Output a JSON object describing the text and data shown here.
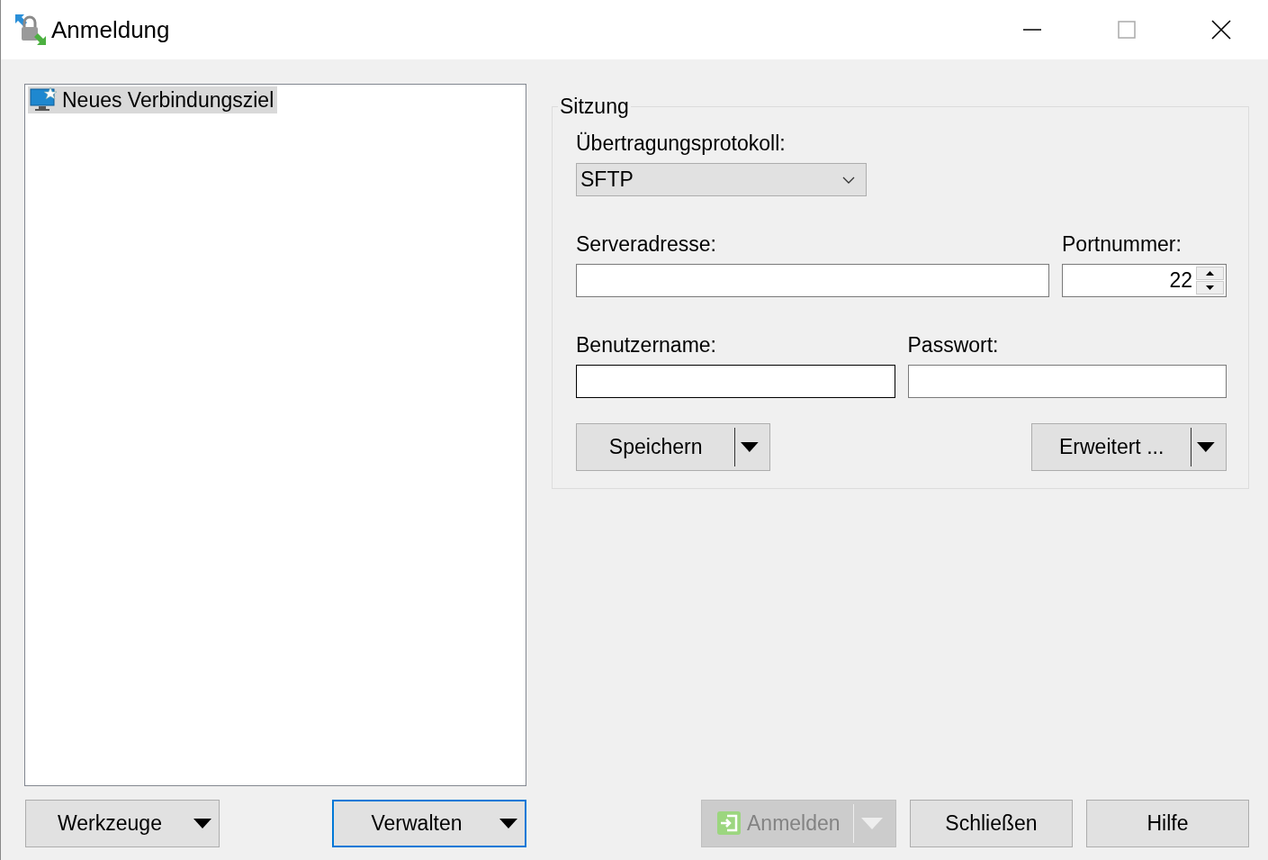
{
  "window": {
    "title": "Anmeldung"
  },
  "sites": [
    {
      "label": "Neues Verbindungsziel",
      "selected": true
    }
  ],
  "session": {
    "title": "Sitzung",
    "protocol": {
      "label": "Übertragungsprotokoll:",
      "value": "SFTP"
    },
    "host": {
      "label": "Serveradresse:"
    },
    "port": {
      "label": "Portnummer:",
      "value": "22"
    },
    "user": {
      "label": "Benutzername:",
      "focused": true
    },
    "password": {
      "label": "Passwort:",
      "focused": false
    },
    "save_button": {
      "label": "Speichern"
    },
    "advanced_button": {
      "label": "Erweitert ..."
    }
  },
  "left_buttons": [
    {
      "label": "Werkzeuge",
      "focused": false
    },
    {
      "label": "Verwalten",
      "focused": true
    }
  ],
  "dialog_buttons": [
    {
      "label": "Anmelden",
      "kind": "split",
      "disabled": true
    },
    {
      "label": "Schließen",
      "kind": "plain",
      "disabled": false
    },
    {
      "label": "Hilfe",
      "kind": "plain",
      "disabled": false
    }
  ]
}
